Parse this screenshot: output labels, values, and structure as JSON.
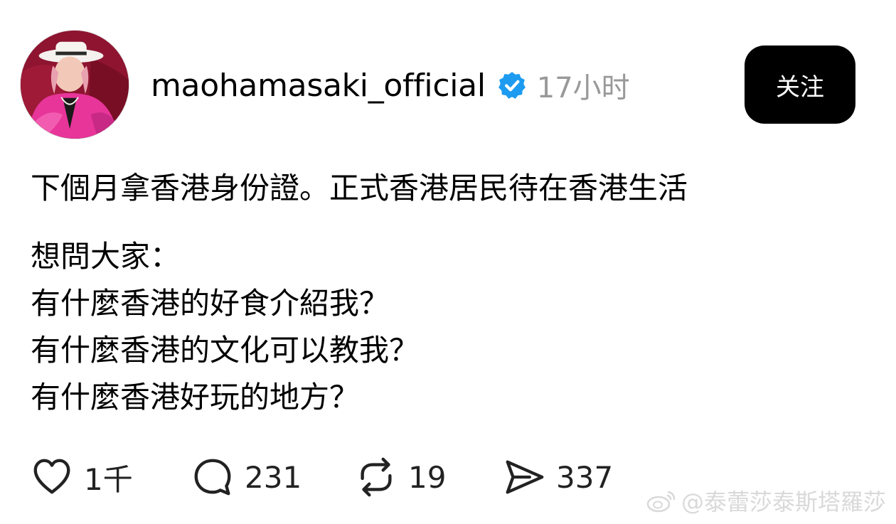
{
  "post": {
    "username": "maohamasaki_official",
    "timestamp": "17小时",
    "follow_label": "关注",
    "content_lines": [
      "下個月拿香港身份證。正式香港居民待在香港生活",
      "想問大家：",
      "有什麼香港的好食介紹我？",
      "有什麼香港的文化可以教我？",
      "有什麼香港好玩的地方？"
    ]
  },
  "actions": {
    "likes": "1千",
    "comments": "231",
    "reposts": "19",
    "shares": "337"
  },
  "watermark": {
    "text": "@泰蕾莎泰斯塔羅莎"
  },
  "colors": {
    "verified_badge": "#1d9bf0",
    "follow_button_bg": "#000000",
    "timestamp": "#999999"
  }
}
